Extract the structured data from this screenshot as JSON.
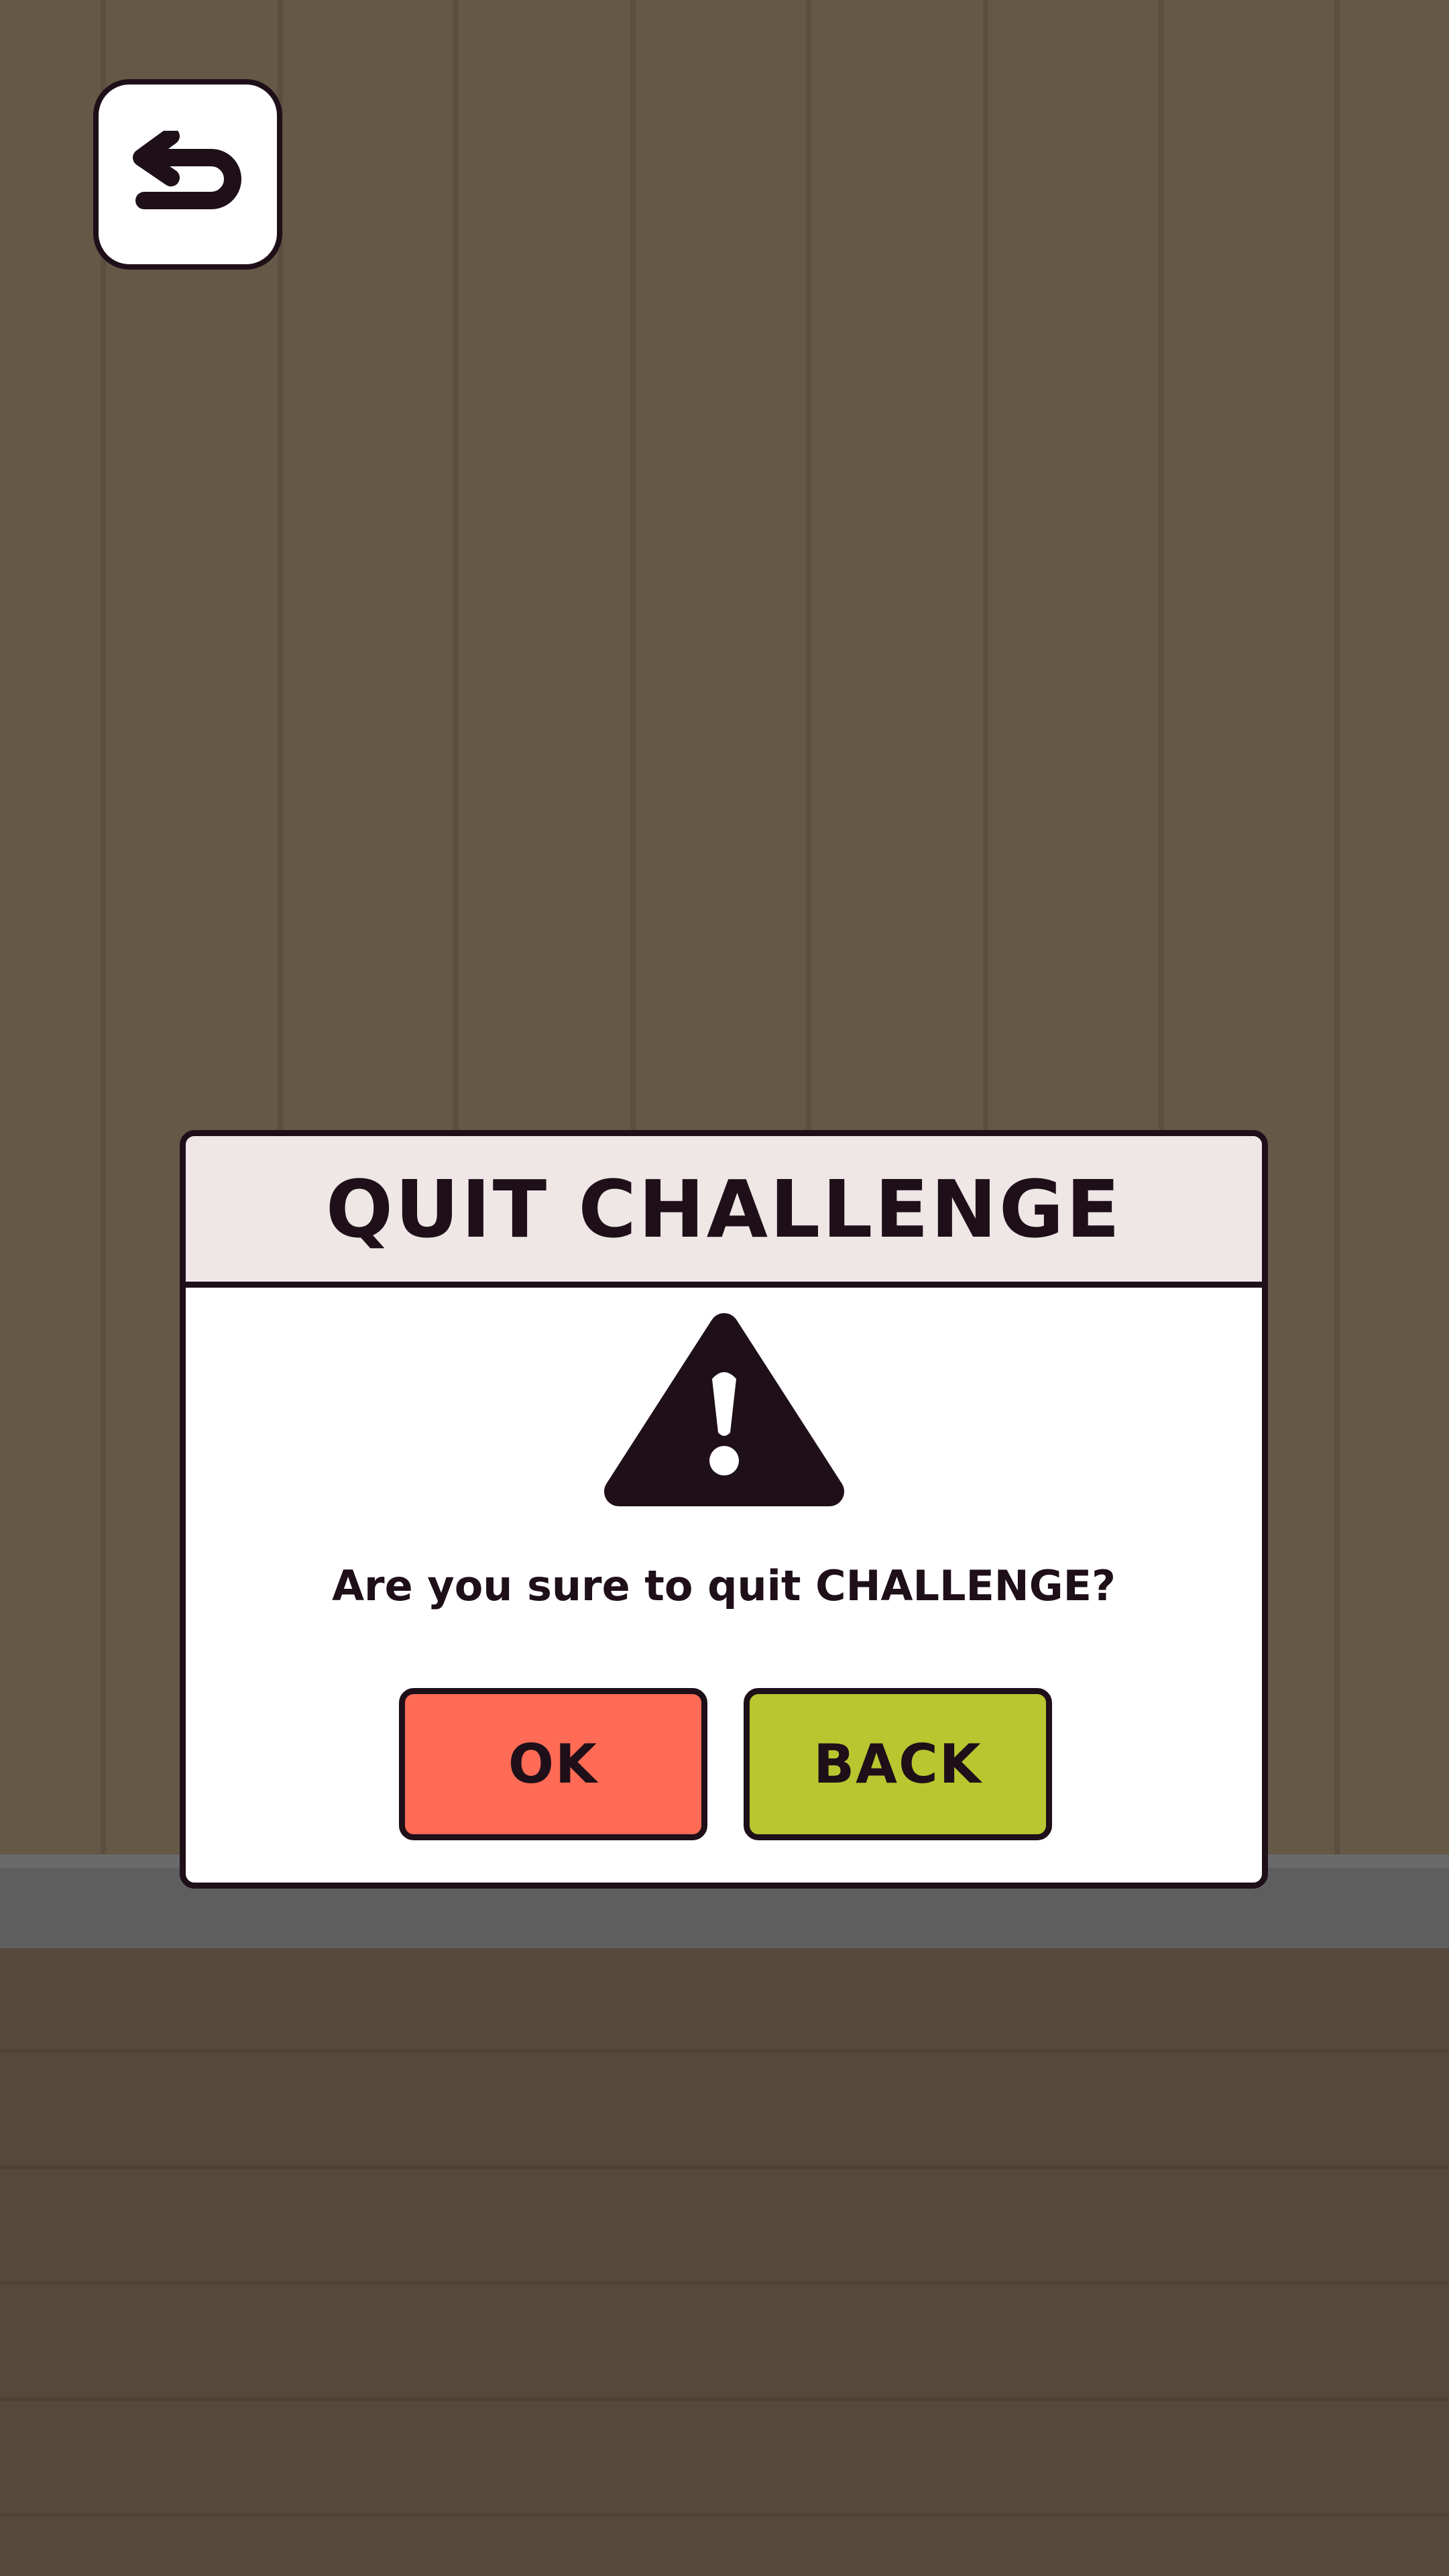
{
  "colors": {
    "wall": "#645946",
    "wall_line": "#5b5040",
    "shelf": "#5e5e5e",
    "floor": "#56493b",
    "outline": "#1e0f19",
    "dialog_header": "#efe6e6",
    "dialog_body": "#ffffff",
    "ok_button": "#ff6b55",
    "back_button": "#b8c730"
  },
  "top_bar": {
    "back_icon": "return-arrow-icon"
  },
  "dialog": {
    "title": "QUIT CHALLENGE",
    "icon": "warning-triangle-icon",
    "message": "Are you sure to quit CHALLENGE?",
    "ok_label": "OK",
    "back_label": "BACK"
  }
}
